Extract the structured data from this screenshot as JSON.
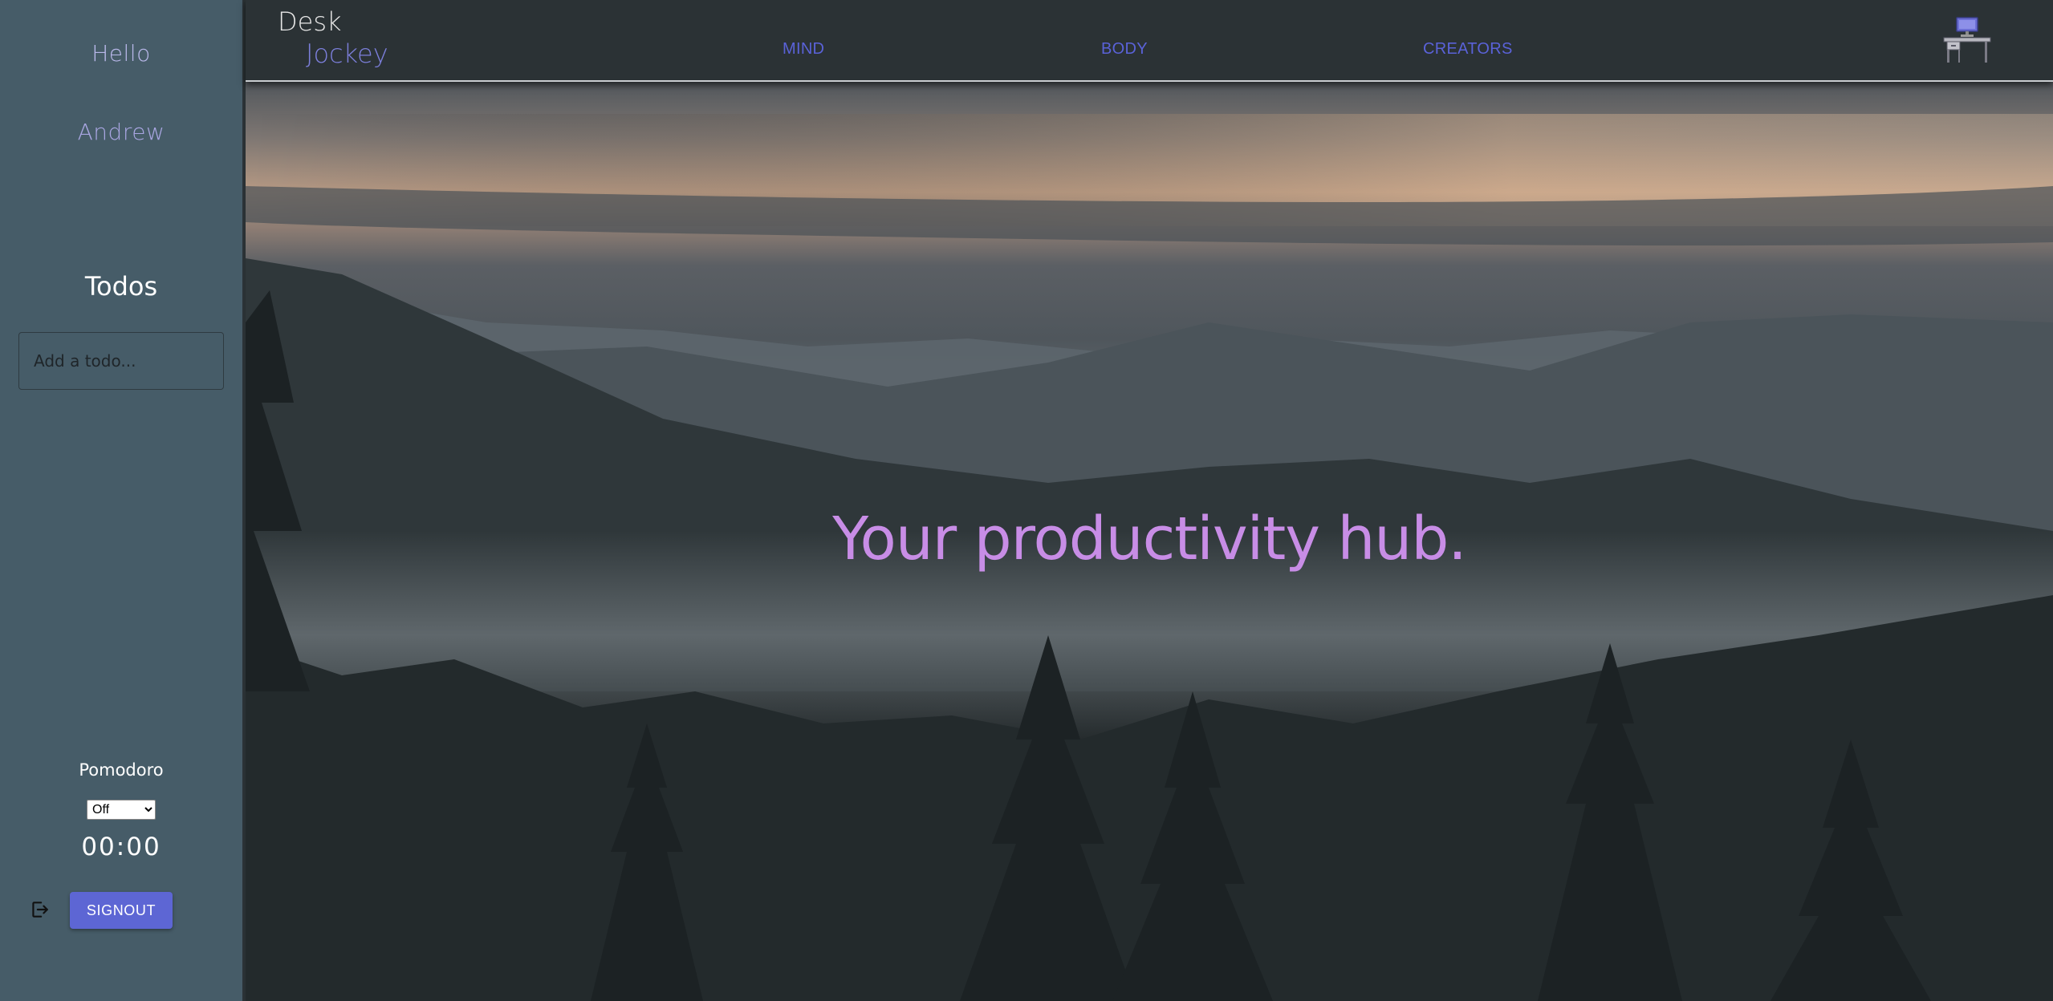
{
  "sidebar": {
    "greeting": "Hello",
    "user_name": "Andrew",
    "todos_title": "Todos",
    "todo_input": {
      "placeholder": "Add a todo...",
      "value": ""
    },
    "pomodoro": {
      "label": "Pomodoro",
      "selected": "Off",
      "timer": "00:00"
    },
    "signout_label": "SIGNOUT",
    "signout_icon": "logout-icon"
  },
  "header": {
    "brand_line1": "Desk",
    "brand_line2": "Jockey",
    "nav": [
      {
        "label": "MIND"
      },
      {
        "label": "BODY"
      },
      {
        "label": "CREATORS"
      }
    ],
    "logo_icon": "desk-computer-icon"
  },
  "hero": {
    "tagline": "Your productivity hub."
  },
  "colors": {
    "sidebar_bg": "#465c68",
    "header_bg": "#2b3235",
    "accent": "#5d66d4",
    "nav_link": "#5a62d8",
    "brand_accent": "#7c7fdb",
    "tagline": "#c88de6"
  }
}
